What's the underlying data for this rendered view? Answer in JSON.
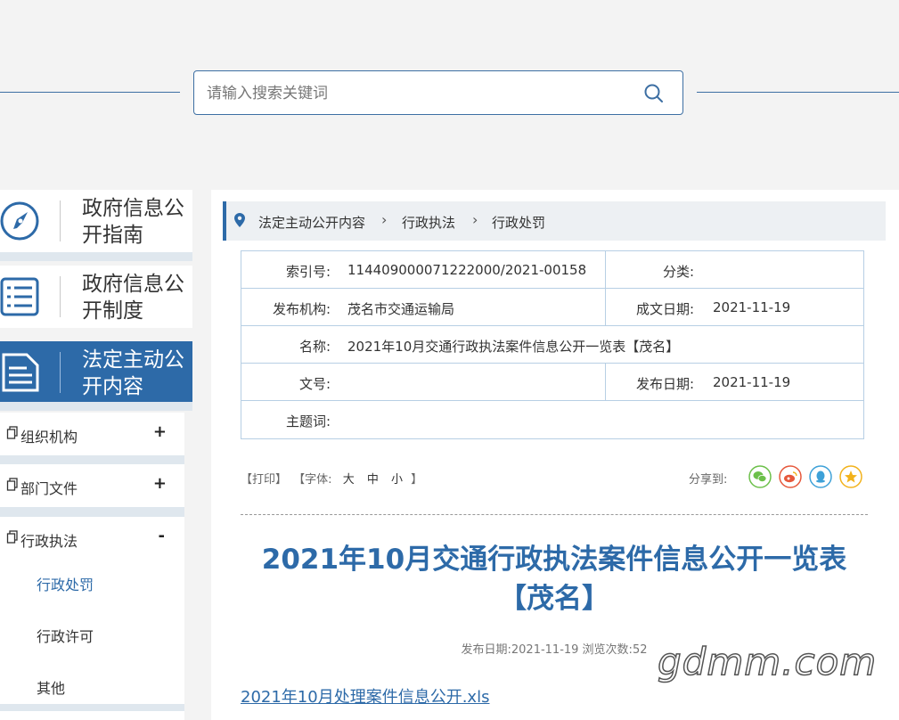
{
  "search": {
    "placeholder": "请输入搜索关键词"
  },
  "sidebar": {
    "cards": [
      {
        "label": "政府信息公开指南"
      },
      {
        "label": "政府信息公开制度"
      },
      {
        "label": "法定主动公开内容"
      }
    ],
    "menu": [
      {
        "label": "组织机构",
        "toggle": "+"
      },
      {
        "label": "部门文件",
        "toggle": "+"
      },
      {
        "label": "行政执法",
        "toggle": "-"
      }
    ],
    "sub_items": [
      "行政处罚",
      "行政许可",
      "其他"
    ]
  },
  "breadcrumb": [
    "法定主动公开内容",
    "行政执法",
    "行政处罚"
  ],
  "info": {
    "index_label": "索引号:",
    "index_value": "114409000071222000/2021-00158",
    "category_label": "分类:",
    "category_value": "",
    "publisher_label": "发布机构:",
    "publisher_value": "茂名市交通运输局",
    "doc_date_label": "成文日期:",
    "doc_date_value": "2021-11-19",
    "name_label": "名称:",
    "name_value": "2021年10月交通行政执法案件信息公开一览表【茂名】",
    "doc_no_label": "文号:",
    "doc_no_value": "",
    "pub_date_label": "发布日期:",
    "pub_date_value": "2021-11-19",
    "subject_label": "主题词:",
    "subject_value": ""
  },
  "tools": {
    "print": "【打印】",
    "font_label": "【字体:",
    "large": "大",
    "medium": "中",
    "small": "小",
    "font_end": "】",
    "share_label": "分享到:"
  },
  "article": {
    "title": "2021年10月交通行政执法案件信息公开一览表【茂名】",
    "meta": "发布日期:2021-11-19  浏览次数:52",
    "attachment": "2021年10月处理案件信息公开.xls"
  },
  "watermark": "gdmm.com",
  "colors": {
    "accent": "#2d6aa8",
    "wechat": "#6cc04a",
    "weibo": "#e6583b",
    "qq": "#3ea1d8",
    "favorite": "#f2b21b"
  }
}
